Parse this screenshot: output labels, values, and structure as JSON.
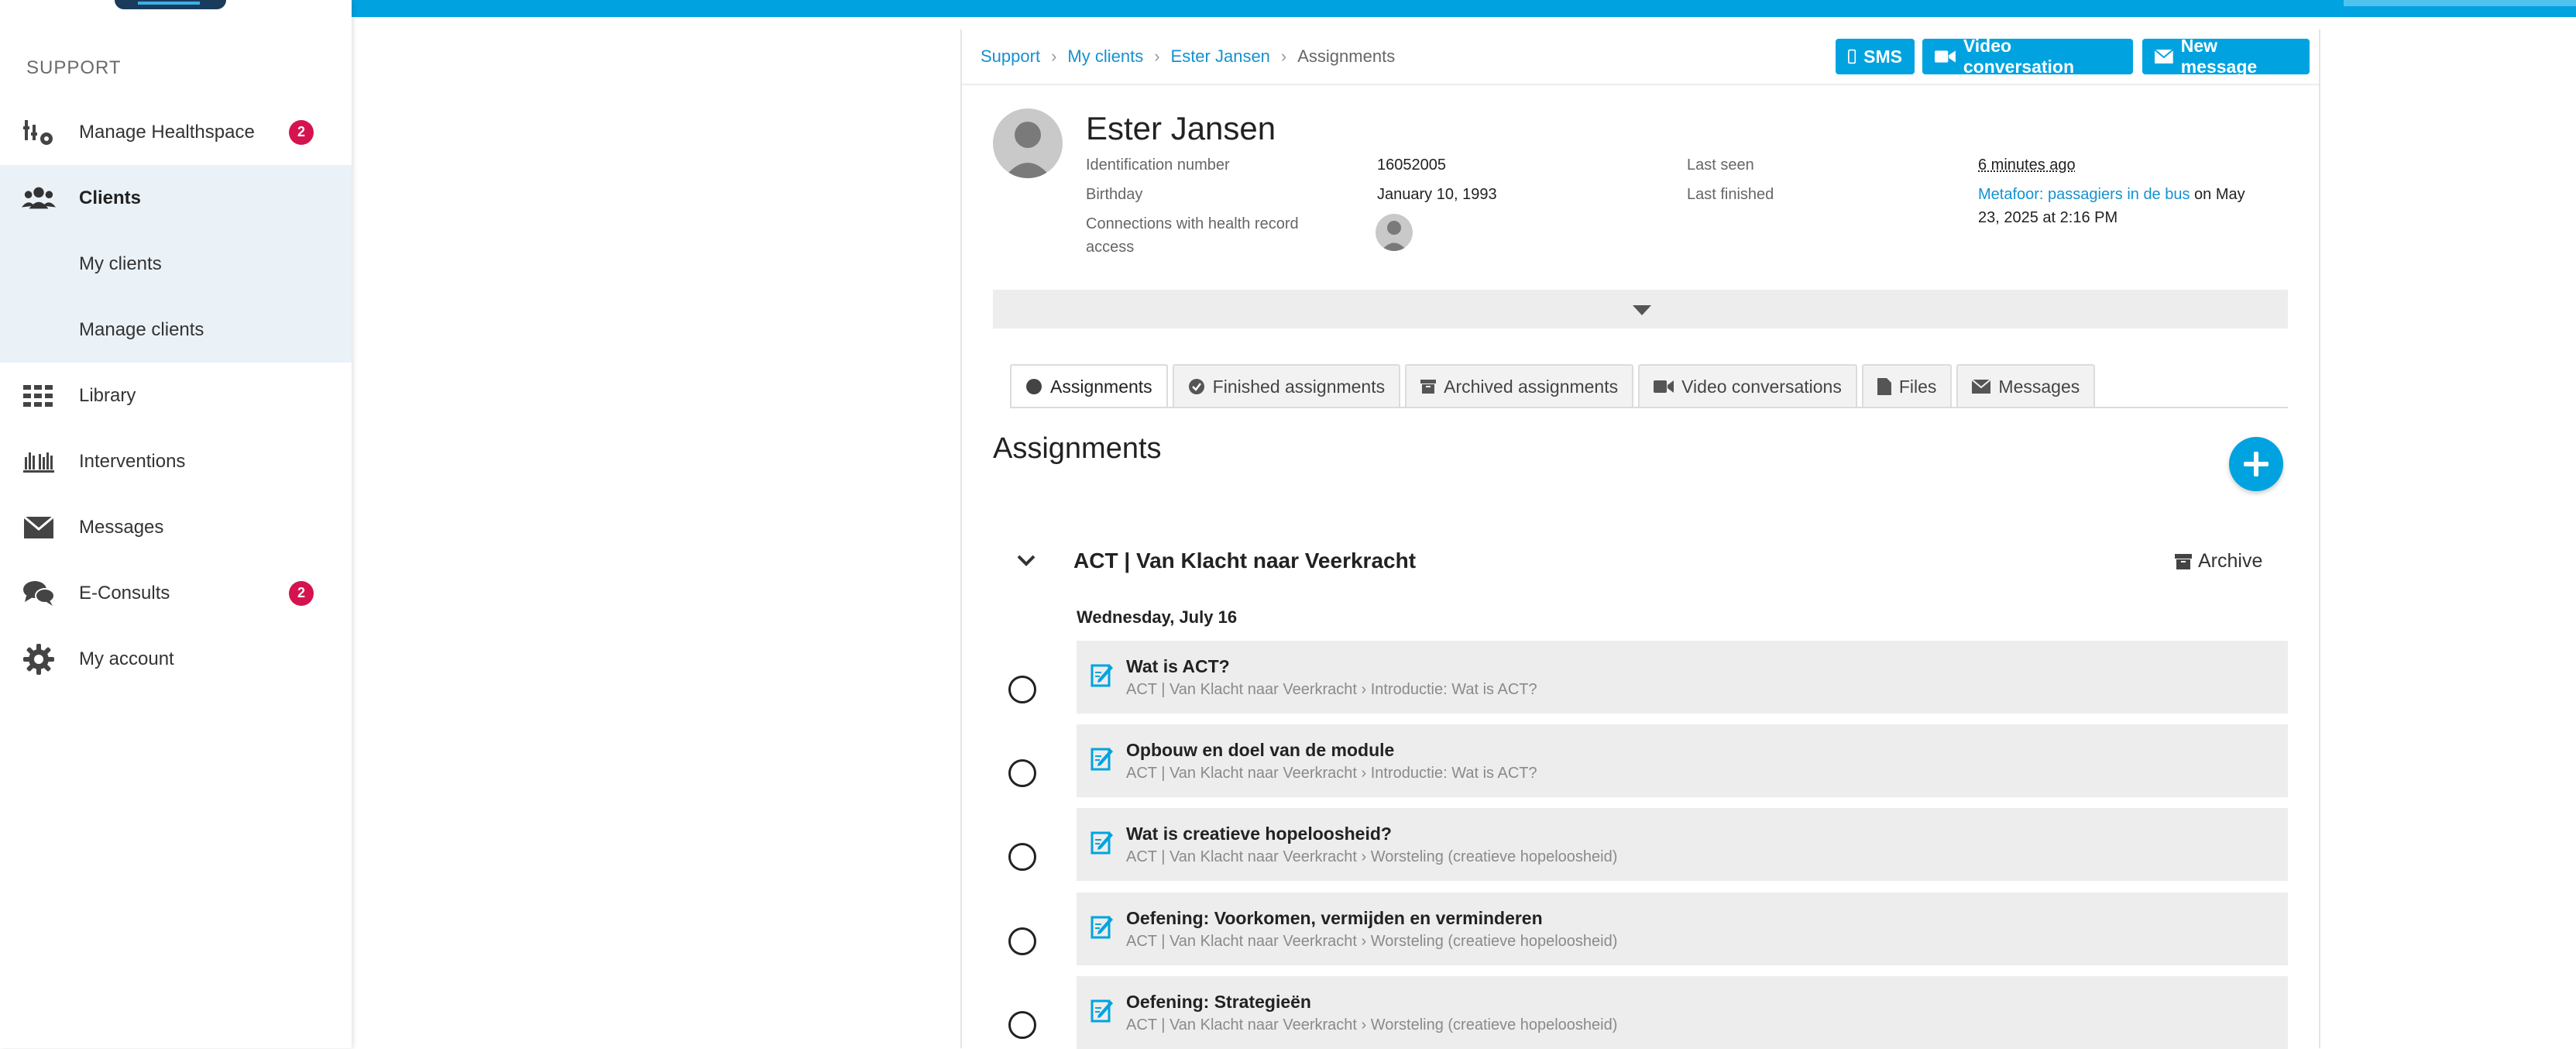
{
  "sidebar": {
    "section_title": "SUPPORT",
    "items": [
      {
        "label": "Manage Healthspace",
        "badge": "2"
      },
      {
        "label": "Clients"
      },
      {
        "label": "My clients"
      },
      {
        "label": "Manage clients"
      },
      {
        "label": "Library"
      },
      {
        "label": "Interventions"
      },
      {
        "label": "Messages"
      },
      {
        "label": "E-Consults",
        "badge": "2"
      },
      {
        "label": "My account"
      }
    ]
  },
  "breadcrumb": [
    "Support",
    "My clients",
    "Ester Jansen",
    "Assignments"
  ],
  "header_buttons": {
    "sms": "SMS",
    "video": "Video conversation",
    "new_message": "New message"
  },
  "client": {
    "name": "Ester Jansen",
    "id_label": "Identification number",
    "id_value": "16052005",
    "birthday_label": "Birthday",
    "birthday_value": "January 10, 1993",
    "connections_label_1": "Connections with health record",
    "connections_label_2": "access",
    "last_seen_label": "Last seen",
    "last_seen_value": "6 minutes ago",
    "last_finished_label": "Last finished",
    "last_finished_link": "Metafoor: passagiers in de bus",
    "last_finished_rest_1": " on May",
    "last_finished_rest_2": "23, 2025 at 2:16 PM"
  },
  "tabs": [
    "Assignments",
    "Finished assignments",
    "Archived assignments",
    "Video conversations",
    "Files",
    "Messages"
  ],
  "section_title": "Assignments",
  "group": {
    "title": "ACT | Van Klacht naar Veerkracht",
    "archive_label": "Archive",
    "date": "Wednesday, July 16"
  },
  "assignments": [
    {
      "title": "Wat is ACT?",
      "path": "ACT | Van Klacht naar Veerkracht › Introductie: Wat is ACT?"
    },
    {
      "title": "Opbouw en doel van de module",
      "path": "ACT | Van Klacht naar Veerkracht › Introductie: Wat is ACT?"
    },
    {
      "title": "Wat is creatieve hopeloosheid?",
      "path": "ACT | Van Klacht naar Veerkracht › Worsteling (creatieve hopeloosheid)"
    },
    {
      "title": "Oefening: Voorkomen, vermijden en verminderen",
      "path": "ACT | Van Klacht naar Veerkracht › Worsteling (creatieve hopeloosheid)"
    },
    {
      "title": "Oefening: Strategieën",
      "path": "ACT | Van Klacht naar Veerkracht › Worsteling (creatieve hopeloosheid)"
    }
  ],
  "colors": {
    "accent": "#00a3e0",
    "badge": "#d5134f",
    "link": "#1591d0"
  }
}
